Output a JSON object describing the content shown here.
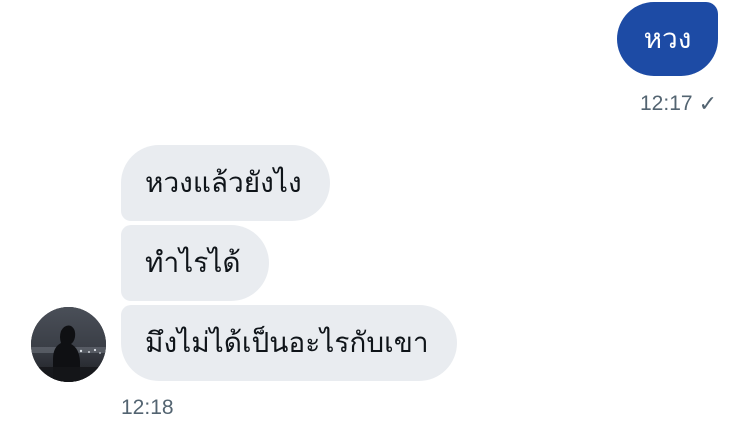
{
  "sent_messages": [
    {
      "text": "หวง",
      "time": "12:17"
    }
  ],
  "received_messages": [
    {
      "text": "หวงแล้วยังไง"
    },
    {
      "text": "ทำไรได้"
    },
    {
      "text": "มึงไม่ได้เป็นอะไรกับเขา"
    }
  ],
  "received_time": "12:18",
  "icons": {
    "read_receipt": "checkmark-icon",
    "avatar": "user-avatar"
  },
  "colors": {
    "sent_bubble": "#1d4ba5",
    "received_bubble": "#e9ecf0",
    "timestamp": "#536471"
  }
}
